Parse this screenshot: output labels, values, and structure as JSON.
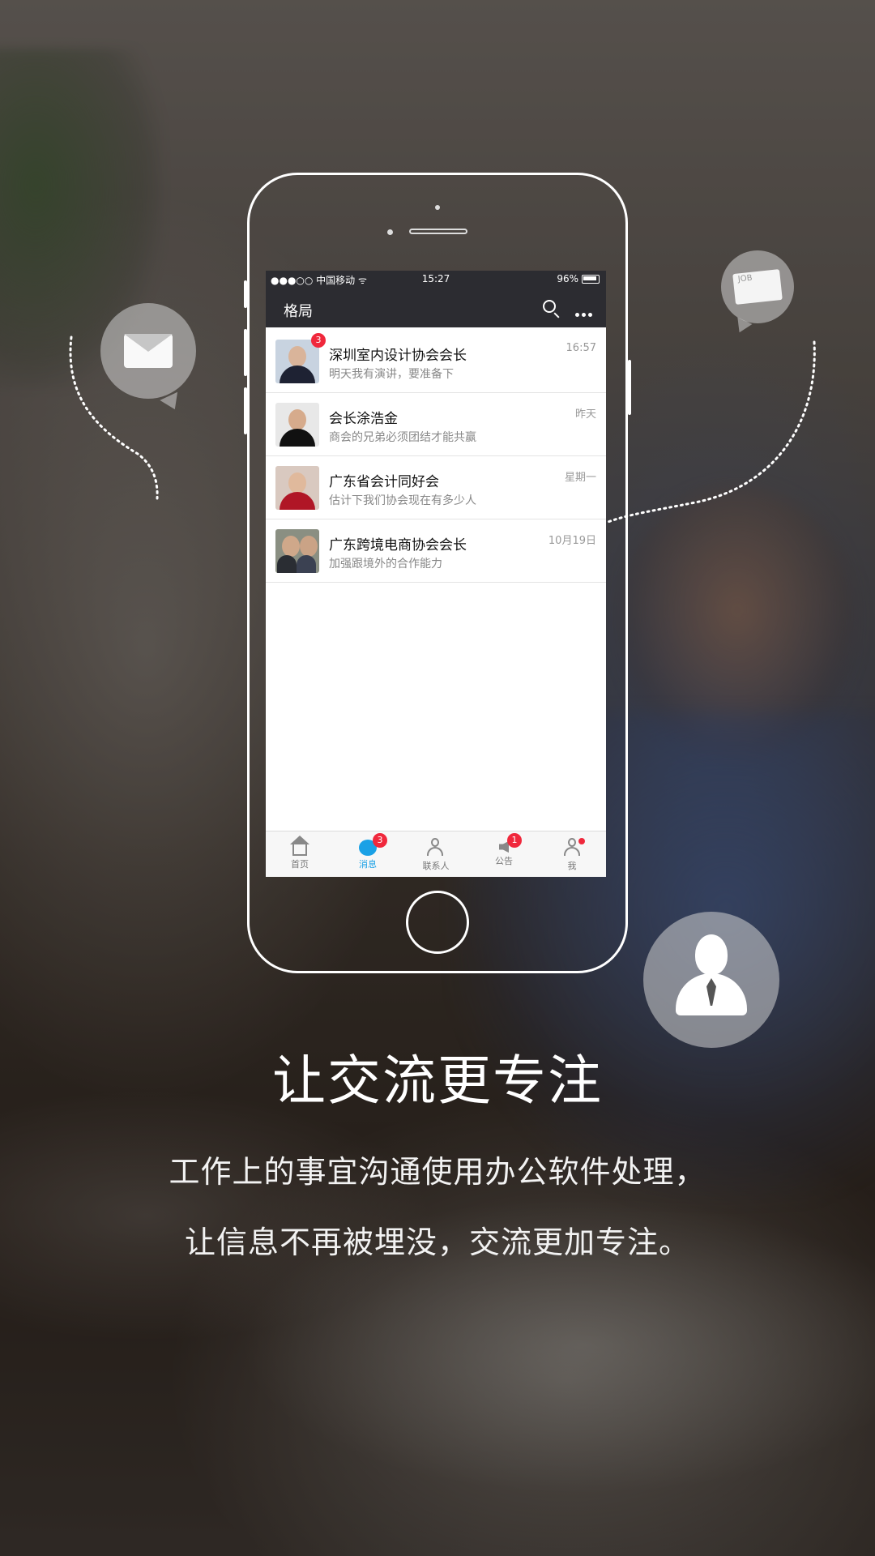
{
  "statusbar": {
    "carrier": "●●●○○ 中国移动 ᯤ",
    "time": "15:27",
    "battery": "96%"
  },
  "navbar": {
    "title": "格局"
  },
  "conversations": [
    {
      "name": "深圳室内设计协会会长",
      "message": "明天我有演讲，要准备下",
      "time": "16:57",
      "badge": "3"
    },
    {
      "name": "会长涂浩金",
      "message": "商会的兄弟必须团结才能共赢",
      "time": "昨天"
    },
    {
      "name": "广东省会计同好会",
      "message": "估计下我们协会现在有多少人",
      "time": "星期一"
    },
    {
      "name": "广东跨境电商协会会长",
      "message": "加强跟境外的合作能力",
      "time": "10月19日"
    }
  ],
  "tabs": [
    {
      "label": "首页",
      "icon": "home-icon"
    },
    {
      "label": "消息",
      "icon": "message-icon",
      "badge": "3",
      "active": true
    },
    {
      "label": "联系人",
      "icon": "contacts-icon"
    },
    {
      "label": "公告",
      "icon": "announcement-icon",
      "badge": "1"
    },
    {
      "label": "我",
      "icon": "profile-icon"
    }
  ],
  "bubbles": {
    "job_text": "JOB"
  },
  "headline": "让交流更专注",
  "subtitle_line1": "工作上的事宜沟通使用办公软件处理，",
  "subtitle_line2": "让信息不再被埋没，交流更加专注。",
  "colors": {
    "accent": "#1aa1e6",
    "badge": "#f0283c",
    "navbar": "#2c2c31"
  }
}
